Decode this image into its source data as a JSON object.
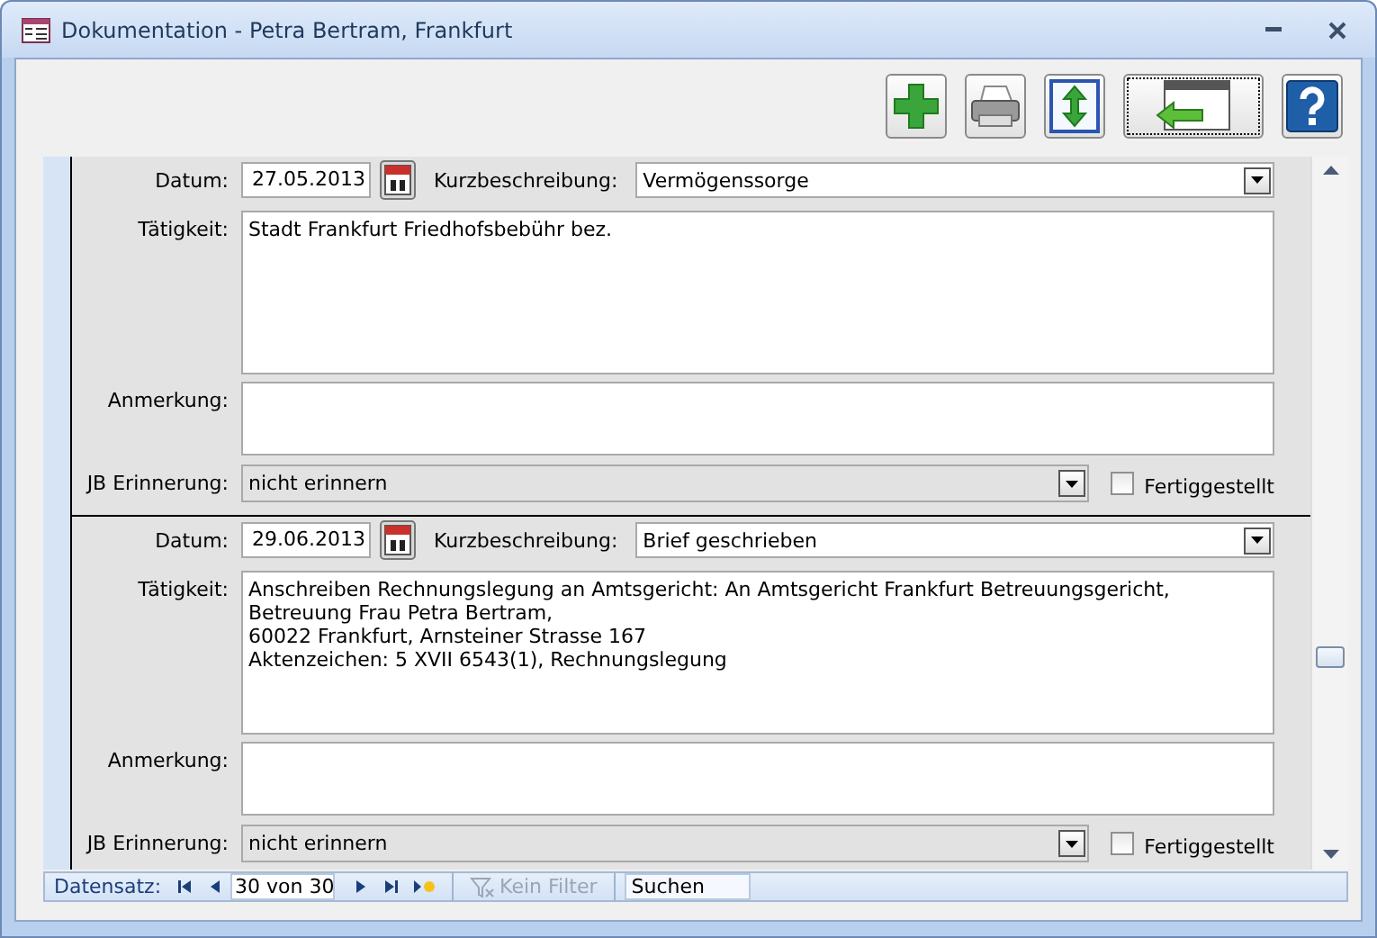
{
  "window": {
    "title": "Dokumentation - Petra Bertram, Frankfurt"
  },
  "records": [
    {
      "date": {
        "label": "Datum:",
        "value": "27.05.2013"
      },
      "summary": {
        "label": "Kurzbeschreibung:",
        "value": "Vermögenssorge"
      },
      "activity": {
        "label": "Tätigkeit:",
        "value": "Stadt Frankfurt Friedhofsbebühr bez."
      },
      "remark": {
        "label": "Anmerkung:"
      },
      "reminder": {
        "label": "JB Erinnerung:",
        "value": "nicht erinnern"
      },
      "done": {
        "label": "Fertiggestellt",
        "checked": false
      }
    },
    {
      "date": {
        "label": "Datum:",
        "value": "29.06.2013"
      },
      "summary": {
        "label": "Kurzbeschreibung:",
        "value": "Brief geschrieben"
      },
      "activity": {
        "label": "Tätigkeit:",
        "value": "Anschreiben Rechnungslegung an Amtsgericht: An Amtsgericht Frankfurt Betreuungsgericht,\nBetreuung Frau Petra Bertram,\n60022 Frankfurt, Arnsteiner Strasse 167\nAktenzeichen: 5 XVII 6543(1), Rechnungslegung"
      },
      "remark": {
        "label": "Anmerkung:"
      },
      "reminder": {
        "label": "JB Erinnerung:",
        "value": "nicht erinnern"
      },
      "done": {
        "label": "Fertiggestellt",
        "checked": false
      }
    }
  ],
  "nav": {
    "label": "Datensatz:",
    "position": "30 von 30",
    "filter": {
      "label": "Kein Filter",
      "disabled": true
    },
    "search": {
      "placeholder": "Suchen"
    }
  }
}
